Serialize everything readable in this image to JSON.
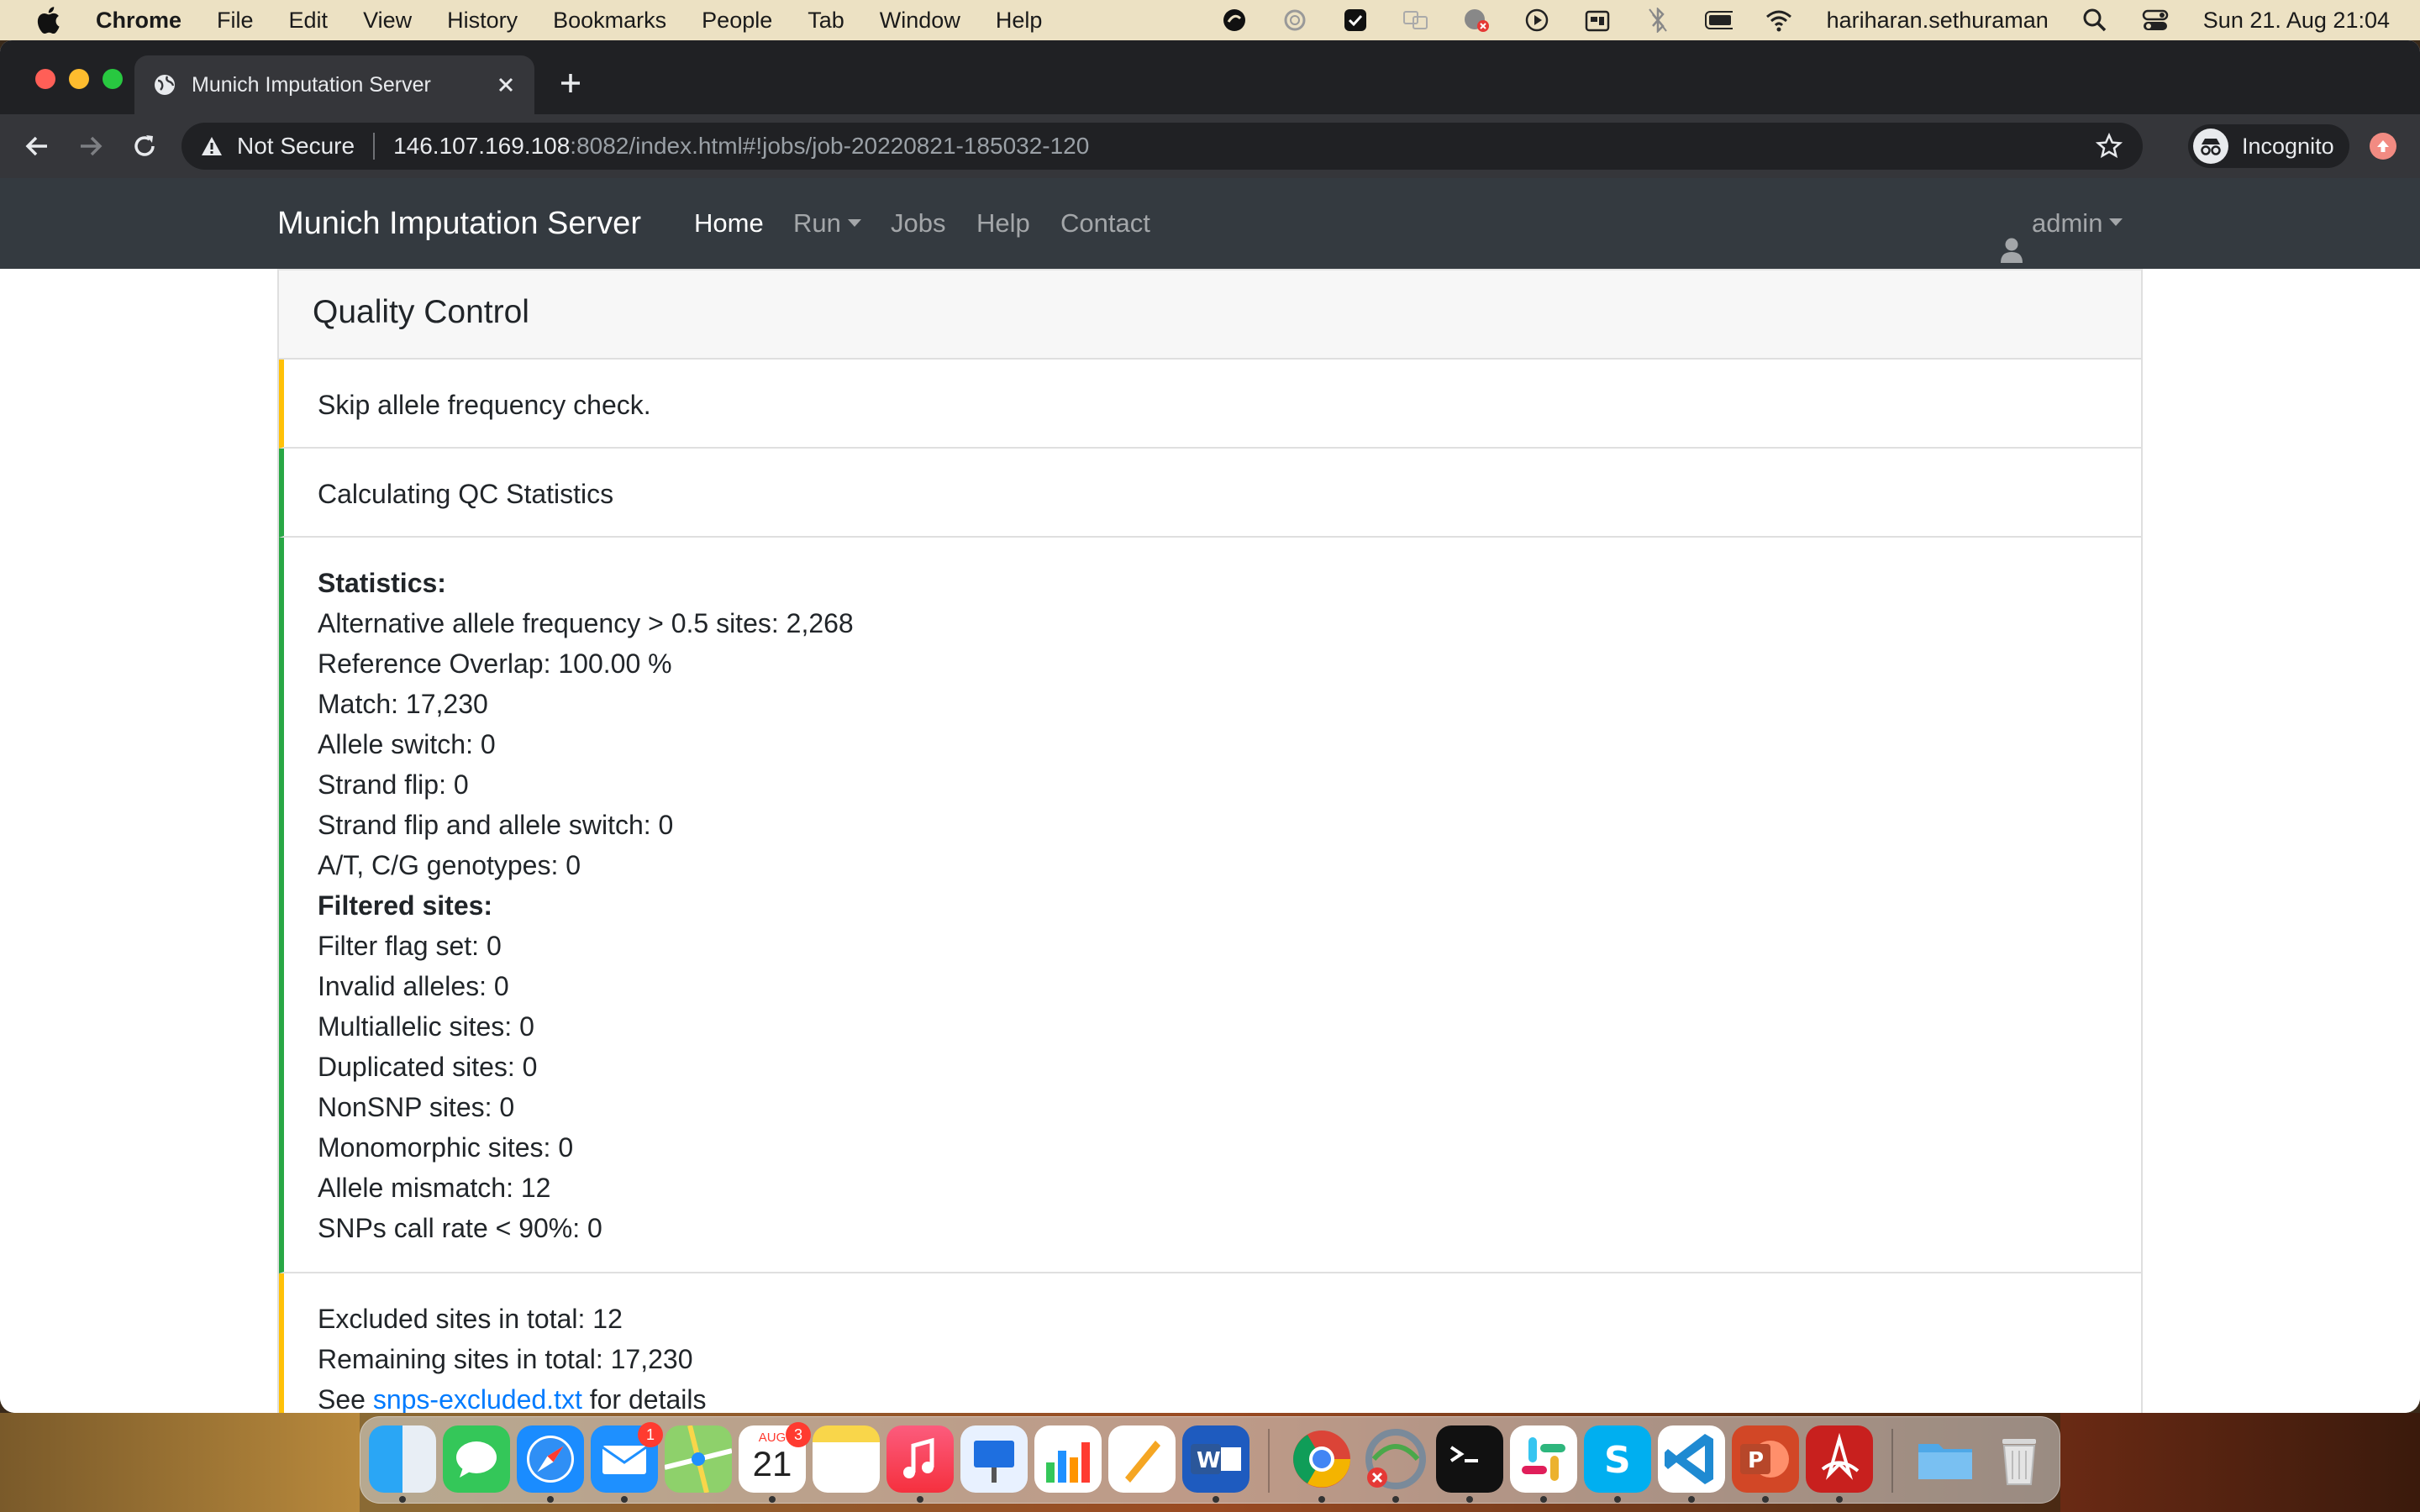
{
  "menubar": {
    "app_name": "Chrome",
    "items": [
      "File",
      "Edit",
      "View",
      "History",
      "Bookmarks",
      "People",
      "Tab",
      "Window",
      "Help"
    ],
    "username": "hariharan.sethuraman",
    "datetime": "Sun 21. Aug  21:04"
  },
  "browser": {
    "tab_title": "Munich Imputation Server",
    "security_label": "Not Secure",
    "url_host": "146.107.169.108",
    "url_rest": ":8082/index.html#!jobs/job-20220821-185032-120",
    "incognito_label": "Incognito"
  },
  "site": {
    "brand": "Munich Imputation Server",
    "nav": [
      "Home",
      "Run",
      "Jobs",
      "Help",
      "Contact"
    ],
    "user": "admin"
  },
  "card": {
    "title": "Quality Control",
    "step1": "Skip allele frequency check.",
    "step2": "Calculating QC Statistics",
    "stats_heading": "Statistics:",
    "stats": [
      "Alternative allele frequency > 0.5 sites: 2,268",
      "Reference Overlap: 100.00 %",
      "Match: 17,230",
      "Allele switch: 0",
      "Strand flip: 0",
      "Strand flip and allele switch: 0",
      "A/T, C/G genotypes: 0"
    ],
    "filtered_heading": "Filtered sites:",
    "filtered": [
      "Filter flag set: 0",
      "Invalid alleles: 0",
      "Multiallelic sites: 0",
      "Duplicated sites: 0",
      "NonSNP sites: 0",
      "Monomorphic sites: 0",
      "Allele mismatch: 12",
      "SNPs call rate < 90%: 0"
    ],
    "excluded_total": "Excluded sites in total: 12",
    "remaining_total": "Remaining sites in total: 17,230",
    "see_prefix": "See",
    "see_link": "snps-excluded.txt",
    "see_suffix": "for details"
  },
  "dock": {
    "mail_badge": "1",
    "calendar_month": "AUG",
    "calendar_day": "21",
    "calendar_badge": "3"
  },
  "colors": {
    "navbar": "#343a40",
    "success_border": "#28a745",
    "warning_border": "#ffc107",
    "link": "#007bff"
  }
}
